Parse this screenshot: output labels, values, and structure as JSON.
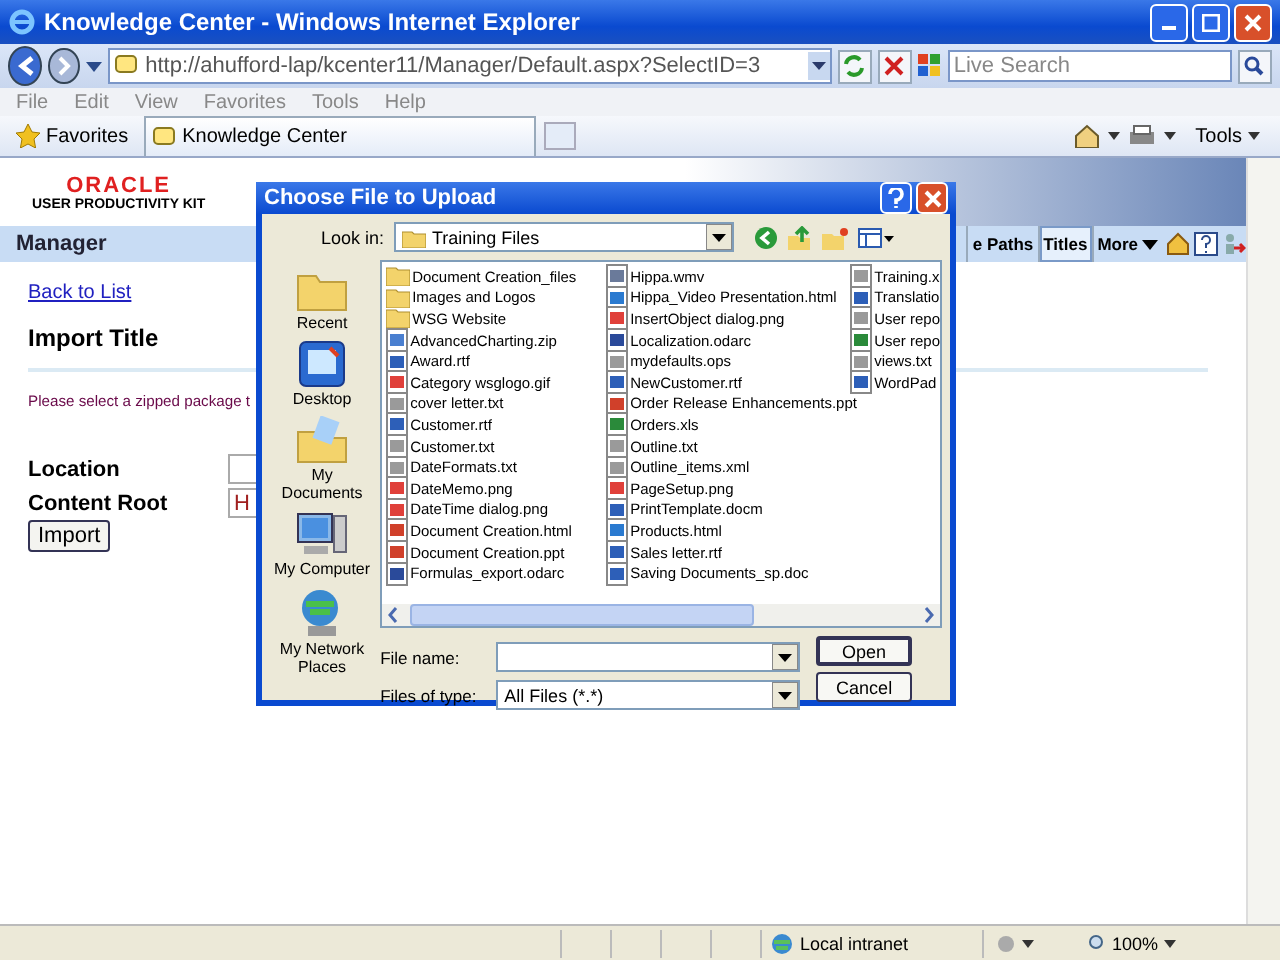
{
  "window": {
    "title": "Knowledge Center - Windows Internet Explorer"
  },
  "address_bar": {
    "url": "http://ahufford-lap/kcenter11/Manager/Default.aspx?SelectID=3"
  },
  "search": {
    "placeholder": "Live Search"
  },
  "menu": [
    "File",
    "Edit",
    "View",
    "Favorites",
    "Tools",
    "Help"
  ],
  "favorites_bar": {
    "favorites": "Favorites",
    "tab": "Knowledge Center",
    "tools": "Tools"
  },
  "page": {
    "logo": {
      "brand": "ORACLE",
      "product": "USER PRODUCTIVITY KIT"
    },
    "nav": {
      "title": "Manager",
      "tabs": [
        {
          "label": "e Paths",
          "selected": false
        },
        {
          "label": "Titles",
          "selected": true
        },
        {
          "label": "More",
          "selected": false
        }
      ]
    },
    "back_link": "Back to List",
    "heading": "Import Title",
    "instruction": "Please select a zipped package t",
    "fields": [
      {
        "label": "Location"
      },
      {
        "label": "Content Root",
        "value": "H"
      }
    ],
    "button": "Import"
  },
  "dialog": {
    "title": "Choose File to Upload",
    "look_in_label": "Look in:",
    "look_in": "Training Files",
    "places": [
      {
        "label": "Recent",
        "kind": "recent"
      },
      {
        "label": "Desktop",
        "kind": "desktop"
      },
      {
        "label": "My Documents",
        "kind": "documents"
      },
      {
        "label": "My Computer",
        "kind": "computer"
      },
      {
        "label": "My Network Places",
        "kind": "network"
      }
    ],
    "columns": [
      [
        {
          "name": "Document Creation_files",
          "kind": "folder"
        },
        {
          "name": "Images and Logos",
          "kind": "folder"
        },
        {
          "name": "WSG Website",
          "kind": "folder"
        },
        {
          "name": "AdvancedCharting.zip",
          "kind": "zip"
        },
        {
          "name": "Award.rtf",
          "kind": "doc"
        },
        {
          "name": "Category wsglogo.gif",
          "kind": "image"
        },
        {
          "name": "cover letter.txt",
          "kind": "text"
        },
        {
          "name": "Customer.rtf",
          "kind": "doc"
        },
        {
          "name": "Customer.txt",
          "kind": "text"
        },
        {
          "name": "DateFormats.txt",
          "kind": "text"
        },
        {
          "name": "DateMemo.png",
          "kind": "image"
        },
        {
          "name": "DateTime dialog.png",
          "kind": "image"
        },
        {
          "name": "Document Creation.html",
          "kind": "ppt"
        },
        {
          "name": "Document Creation.ppt",
          "kind": "ppt"
        },
        {
          "name": "Formulas_export.odarc",
          "kind": "chart"
        }
      ],
      [
        {
          "name": "Hippa.wmv",
          "kind": "media"
        },
        {
          "name": "Hippa_Video Presentation.html",
          "kind": "html"
        },
        {
          "name": "InsertObject dialog.png",
          "kind": "image"
        },
        {
          "name": "Localization.odarc",
          "kind": "chart"
        },
        {
          "name": "mydefaults.ops",
          "kind": "text"
        },
        {
          "name": "NewCustomer.rtf",
          "kind": "doc"
        },
        {
          "name": "Order Release Enhancements.ppt",
          "kind": "ppt"
        },
        {
          "name": "Orders.xls",
          "kind": "xls"
        },
        {
          "name": "Outline.txt",
          "kind": "text"
        },
        {
          "name": "Outline_items.xml",
          "kind": "text"
        },
        {
          "name": "PageSetup.png",
          "kind": "image"
        },
        {
          "name": "PrintTemplate.docm",
          "kind": "doc"
        },
        {
          "name": "Products.html",
          "kind": "html"
        },
        {
          "name": "Sales letter.rtf",
          "kind": "doc"
        },
        {
          "name": "Saving Documents_sp.doc",
          "kind": "doc"
        }
      ],
      [
        {
          "name": "Training.x",
          "kind": "text"
        },
        {
          "name": "Translatio",
          "kind": "doc"
        },
        {
          "name": "User repo",
          "kind": "text"
        },
        {
          "name": "User repo",
          "kind": "xls"
        },
        {
          "name": "views.txt",
          "kind": "text"
        },
        {
          "name": "WordPad",
          "kind": "doc"
        }
      ]
    ],
    "file_name_label": "File name:",
    "file_type_label": "Files of type:",
    "file_type": "All Files (*.*)",
    "buttons": [
      "Open",
      "Cancel"
    ]
  },
  "status_bar": {
    "zone": "Local intranet",
    "zoom": "100%"
  }
}
